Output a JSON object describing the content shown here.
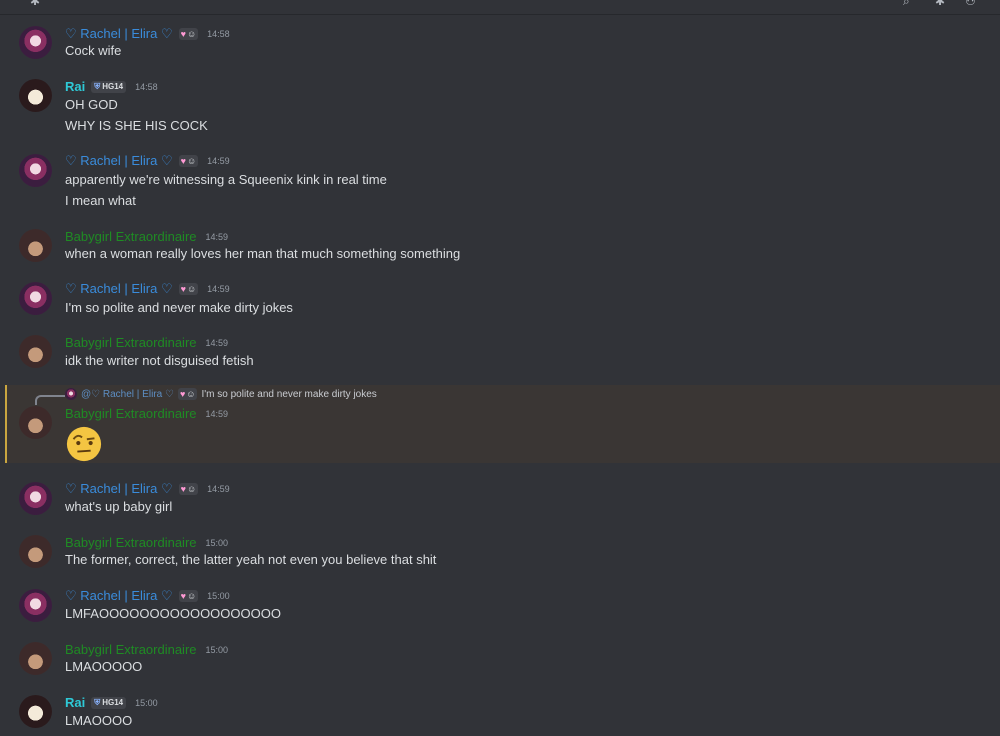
{
  "icons": {
    "top_left": "thread-icon",
    "top_right_a": "search-icon",
    "top_right_b": "settings-icon"
  },
  "badge_heart": "♡",
  "rai_badge": "HG14",
  "messages": [
    {
      "user": "♡ Rachel | Elira ♡",
      "time": "14:58",
      "lines": [
        "Cock wife"
      ]
    },
    {
      "user": "Rai",
      "time": "14:58",
      "lines": [
        "OH GOD",
        "WHY IS SHE HIS COCK"
      ]
    },
    {
      "user": "♡ Rachel | Elira ♡",
      "time": "14:59",
      "lines": [
        "apparently we're witnessing a Squeenix kink in real time",
        "I mean what"
      ]
    },
    {
      "user": "Babygirl Extraordinaire",
      "time": "14:59",
      "lines": [
        "when a woman really loves her man that much something something"
      ]
    },
    {
      "user": "♡ Rachel | Elira ♡",
      "time": "14:59",
      "lines": [
        "I'm so polite and never make dirty jokes"
      ]
    },
    {
      "user": "Babygirl Extraordinaire",
      "time": "14:59",
      "lines": [
        "idk the writer not disguised fetish"
      ]
    },
    {
      "user": "Babygirl Extraordinaire",
      "time": "14:59",
      "lines": [],
      "reply": {
        "name": "@♡ Rachel | Elira ♡",
        "text": "I'm so polite and never make dirty jokes"
      },
      "emoji": "face-with-raised-eyebrow-emoji"
    },
    {
      "user": "♡ Rachel | Elira ♡",
      "time": "14:59",
      "lines": [
        "what's up baby girl"
      ]
    },
    {
      "user": "Babygirl Extraordinaire",
      "time": "15:00",
      "lines": [
        "The former, correct, the latter yeah not even you believe that shit"
      ]
    },
    {
      "user": "♡ Rachel | Elira ♡",
      "time": "15:00",
      "lines": [
        "LMFAOOOOOOOOOOOOOOOOOO"
      ]
    },
    {
      "user": "Babygirl Extraordinaire",
      "time": "15:00",
      "lines": [
        "LMAOOOOO"
      ]
    },
    {
      "user": "Rai",
      "time": "15:00",
      "lines": [
        "LMAOOOO"
      ]
    }
  ]
}
